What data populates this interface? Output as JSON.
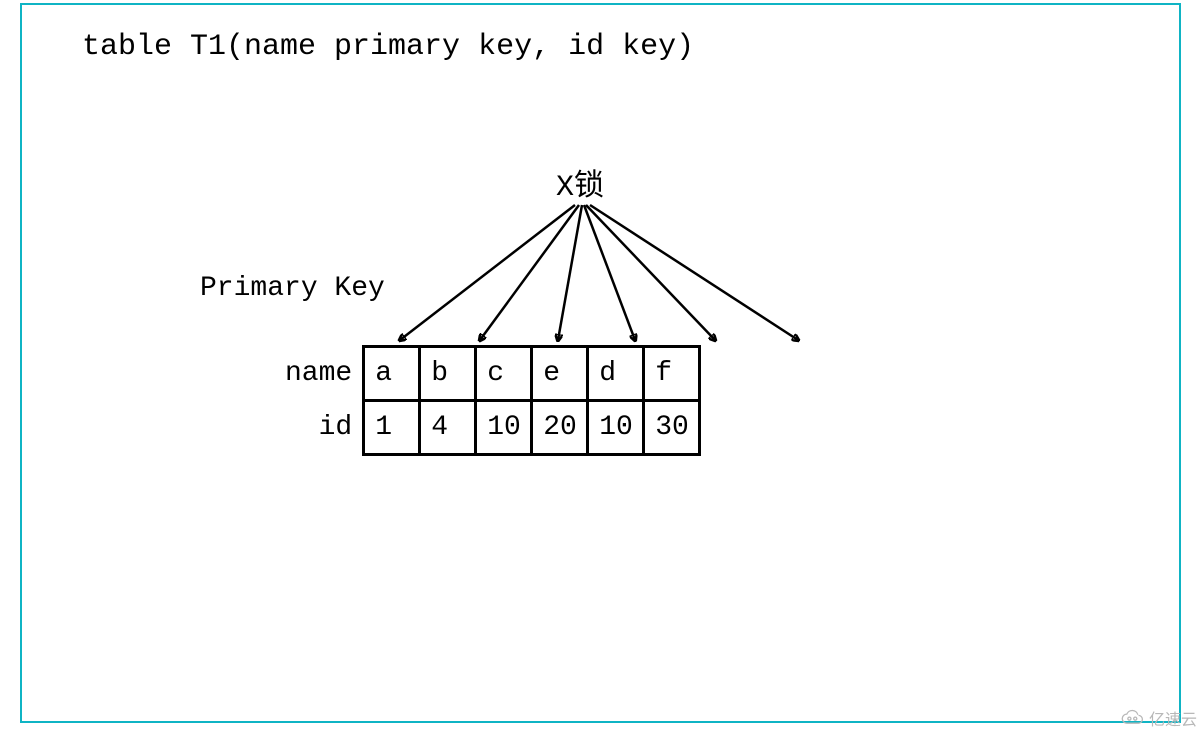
{
  "title": "table T1(name primary key, id key)",
  "lock_label": "X锁",
  "pk_label": "Primary Key",
  "row_name_label": "name",
  "row_id_label": "id",
  "columns": {
    "names": [
      "a",
      "b",
      "c",
      "e",
      "d",
      "f"
    ],
    "ids": [
      "1",
      "4",
      "10",
      "20",
      "10",
      "30"
    ]
  },
  "watermark": "亿速云",
  "chart_data": {
    "type": "table",
    "title": "table T1(name primary key, id key)",
    "annotation": "X锁 points to every row of Primary Key table",
    "columns": [
      "name",
      "id"
    ],
    "rows": [
      {
        "name": "a",
        "id": 1
      },
      {
        "name": "b",
        "id": 4
      },
      {
        "name": "c",
        "id": 10
      },
      {
        "name": "e",
        "id": 20
      },
      {
        "name": "d",
        "id": 10
      },
      {
        "name": "f",
        "id": 30
      }
    ]
  }
}
